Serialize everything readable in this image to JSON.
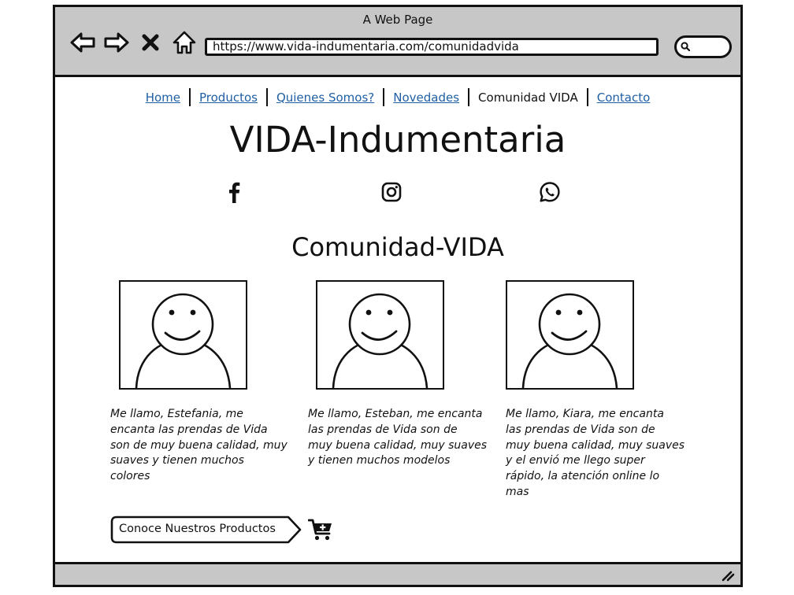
{
  "window": {
    "title": "A Web Page"
  },
  "browser": {
    "url": "https://www.vida-indumentaria.com/comunidadvida",
    "back_icon": "back-arrow-icon",
    "forward_icon": "forward-arrow-icon",
    "close_icon": "close-icon",
    "home_icon": "home-icon",
    "search_icon": "search-icon"
  },
  "site_nav": {
    "items": [
      {
        "label": "Home",
        "link": true
      },
      {
        "label": "Productos",
        "link": true
      },
      {
        "label": "Quienes Somos?",
        "link": true
      },
      {
        "label": "Novedades",
        "link": true
      },
      {
        "label": "Comunidad VIDA",
        "link": false
      },
      {
        "label": "Contacto",
        "link": true
      }
    ]
  },
  "site": {
    "title": "VIDA-Indumentaria"
  },
  "social": {
    "icons": [
      "facebook-icon",
      "instagram-icon",
      "whatsapp-icon"
    ]
  },
  "section": {
    "title": "Comunidad-VIDA"
  },
  "testimonials": [
    {
      "name": "Estefania",
      "lines": [
        "Me llamo, Estefania, me",
        "encanta las prendas de Vida",
        "son de muy buena calidad, muy",
        "suaves y tienen muchos",
        "colores"
      ]
    },
    {
      "name": "Esteban",
      "lines": [
        "Me llamo, Esteban, me encanta",
        "las prendas de Vida son de",
        "muy buena calidad, muy suaves",
        "y tienen muchos modelos"
      ]
    },
    {
      "name": "Kiara",
      "lines": [
        "Me llamo, Kiara, me encanta",
        "las prendas de Vida son de",
        "muy buena calidad, muy suaves",
        "y el envió me llego super",
        "rápido, la atención online lo",
        "mas"
      ]
    }
  ],
  "cta": {
    "label": "Conoce Nuestros Productos",
    "icon": "add-to-cart-icon"
  },
  "colors": {
    "chrome": "#c7c7c7",
    "link": "#1f5fa4",
    "ink": "#111111"
  }
}
